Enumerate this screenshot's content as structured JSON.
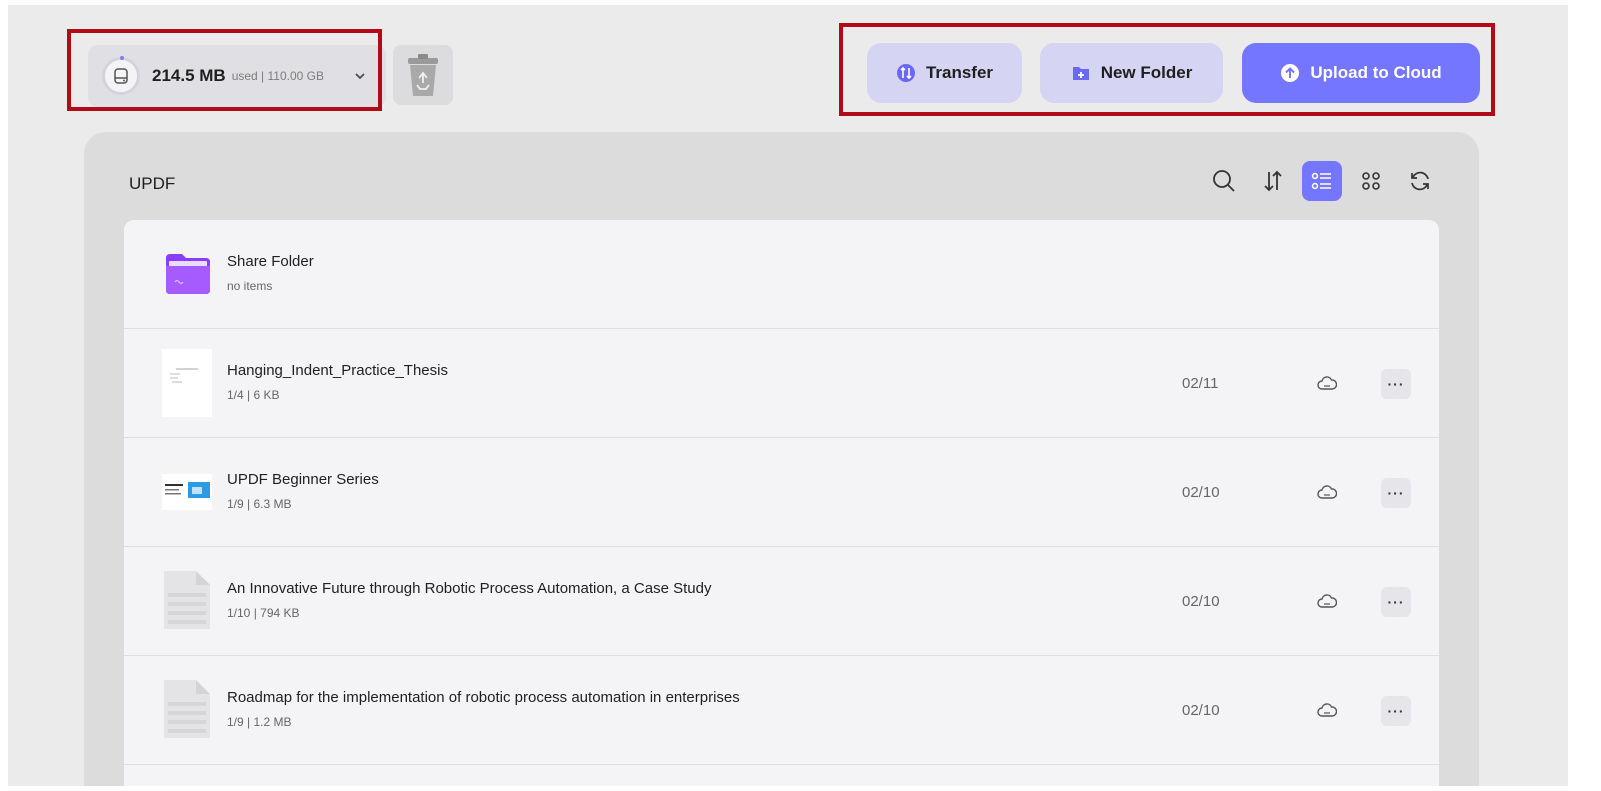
{
  "storage": {
    "used": "214.5 MB",
    "total": "used | 110.00 GB"
  },
  "actions": {
    "transfer": "Transfer",
    "new_folder": "New Folder",
    "upload": "Upload to Cloud"
  },
  "panel": {
    "title": "UPDF"
  },
  "files": [
    {
      "name": "Share Folder",
      "meta": "no items",
      "date": "",
      "type": "folder"
    },
    {
      "name": "Hanging_Indent_Practice_Thesis",
      "meta": "1/4 | 6 KB",
      "date": "02/11",
      "type": "doc"
    },
    {
      "name": "UPDF Beginner Series",
      "meta": "1/9 | 6.3 MB",
      "date": "02/10",
      "type": "slides"
    },
    {
      "name": "An Innovative Future through Robotic Process Automation, a Case Study",
      "meta": "1/10 | 794 KB",
      "date": "02/10",
      "type": "pdf"
    },
    {
      "name": "Roadmap for the implementation of robotic process automation in enterprises",
      "meta": "1/9 | 1.2 MB",
      "date": "02/10",
      "type": "pdf"
    }
  ],
  "colors": {
    "accent": "#7476ff",
    "accent_soft": "#d6d4f3",
    "highlight_box": "#b30a1a",
    "folder": "#9b4dff"
  }
}
